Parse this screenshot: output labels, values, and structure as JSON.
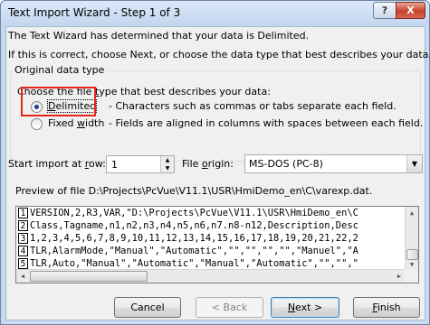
{
  "window": {
    "title": "Text Import Wizard - Step 1 of 3",
    "help_label": "?",
    "close_label": "X"
  },
  "intro": {
    "line1": "The Text Wizard has determined that your data is Delimited.",
    "line2": "If this is correct, choose Next, or choose the data type that best describes your data."
  },
  "data_type_group": {
    "title": "Original data type",
    "prompt_pre": "Choose the file ",
    "prompt_u": "t",
    "prompt_post": "ype that best describes your data:",
    "options": [
      {
        "pre": "",
        "u": "D",
        "post": "elimited",
        "description": "- Characters such as commas or tabs separate each field.",
        "checked": true
      },
      {
        "pre": "Fixed ",
        "u": "w",
        "post": "idth",
        "description": "- Fields are aligned in columns with spaces between each field.",
        "checked": false
      }
    ]
  },
  "start_row": {
    "label_pre": "Start import at ",
    "label_u": "r",
    "label_post": "ow:",
    "value": "1"
  },
  "file_origin": {
    "label_pre": "File ",
    "label_u": "o",
    "label_post": "rigin:",
    "value": "MS-DOS (PC-8)"
  },
  "preview": {
    "label": "Preview of file D:\\Projects\\PcVue\\V11.1\\USR\\HmiDemo_en\\C\\varexp.dat.",
    "rows": [
      {
        "num": "1",
        "text": "VERSION,2,R3,VAR,\"D:\\Projects\\PcVue\\V11.1\\USR\\HmiDemo_en\\C"
      },
      {
        "num": "2",
        "text": "Class,Tagname,n1,n2,n3,n4,n5,n6,n7.n8-n12,Description,Desc"
      },
      {
        "num": "3",
        "text": "1,2,3,4,5,6,7,8,9,10,11,12,13,14,15,16,17,18,19,20,21,22,2"
      },
      {
        "num": "4",
        "text": "TLR,AlarmMode,\"Manual\",\"Automatic\",\"\",\"\",\"\",\"\",\"Manuel\",\"A"
      },
      {
        "num": "5",
        "text": "TLR,Auto,\"Manual\",\"Automatic\",\"Manual\",\"Automatic\",\"\",\"\",\""
      }
    ]
  },
  "buttons": {
    "cancel": "Cancel",
    "back": "< Back",
    "next_u": "N",
    "next_post": "ext >",
    "finish_u": "F",
    "finish_post": "inish"
  }
}
